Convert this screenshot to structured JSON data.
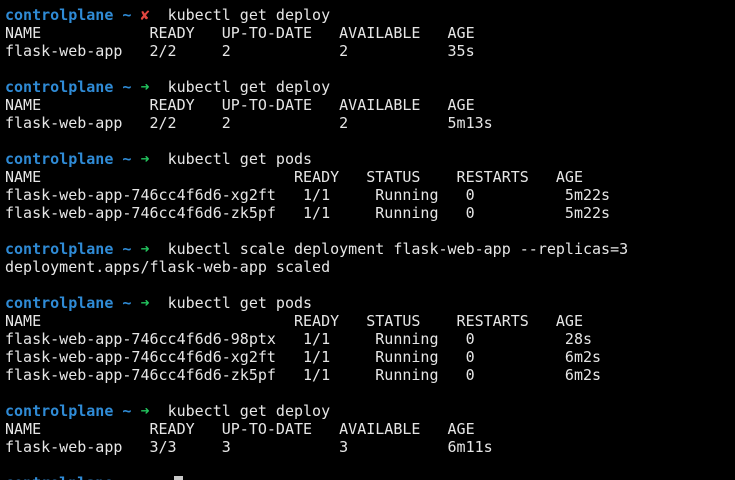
{
  "colors": {
    "background": "#000000",
    "prompt_host": "#2f8bd6",
    "status_fail": "#e0463f",
    "status_ok": "#22c55e",
    "text": "#e6e6e6"
  },
  "terminal": {
    "lines": [
      {
        "type": "prompt",
        "host": "controlplane",
        "tilde": "~",
        "status": "fail",
        "status_glyph": "✘",
        "command": "kubectl get deploy"
      },
      {
        "type": "output",
        "text": "NAME            READY   UP-TO-DATE   AVAILABLE   AGE"
      },
      {
        "type": "output",
        "text": "flask-web-app   2/2     2            2           35s"
      },
      {
        "type": "blank",
        "text": ""
      },
      {
        "type": "prompt",
        "host": "controlplane",
        "tilde": "~",
        "status": "ok",
        "status_glyph": "➜",
        "command": "kubectl get deploy"
      },
      {
        "type": "output",
        "text": "NAME            READY   UP-TO-DATE   AVAILABLE   AGE"
      },
      {
        "type": "output",
        "text": "flask-web-app   2/2     2            2           5m13s"
      },
      {
        "type": "blank",
        "text": ""
      },
      {
        "type": "prompt",
        "host": "controlplane",
        "tilde": "~",
        "status": "ok",
        "status_glyph": "➜",
        "command": "kubectl get pods"
      },
      {
        "type": "output",
        "text": "NAME                            READY   STATUS    RESTARTS   AGE"
      },
      {
        "type": "output",
        "text": "flask-web-app-746cc4f6d6-xg2ft   1/1     Running   0          5m22s"
      },
      {
        "type": "output",
        "text": "flask-web-app-746cc4f6d6-zk5pf   1/1     Running   0          5m22s"
      },
      {
        "type": "blank",
        "text": ""
      },
      {
        "type": "prompt",
        "host": "controlplane",
        "tilde": "~",
        "status": "ok",
        "status_glyph": "➜",
        "command": "kubectl scale deployment flask-web-app --replicas=3"
      },
      {
        "type": "output",
        "text": "deployment.apps/flask-web-app scaled"
      },
      {
        "type": "blank",
        "text": ""
      },
      {
        "type": "prompt",
        "host": "controlplane",
        "tilde": "~",
        "status": "ok",
        "status_glyph": "➜",
        "command": "kubectl get pods"
      },
      {
        "type": "output",
        "text": "NAME                            READY   STATUS    RESTARTS   AGE"
      },
      {
        "type": "output",
        "text": "flask-web-app-746cc4f6d6-98ptx   1/1     Running   0          28s"
      },
      {
        "type": "output",
        "text": "flask-web-app-746cc4f6d6-xg2ft   1/1     Running   0          6m2s"
      },
      {
        "type": "output",
        "text": "flask-web-app-746cc4f6d6-zk5pf   1/1     Running   0          6m2s"
      },
      {
        "type": "blank",
        "text": ""
      },
      {
        "type": "prompt",
        "host": "controlplane",
        "tilde": "~",
        "status": "ok",
        "status_glyph": "➜",
        "command": "kubectl get deploy"
      },
      {
        "type": "output",
        "text": "NAME            READY   UP-TO-DATE   AVAILABLE   AGE"
      },
      {
        "type": "output",
        "text": "flask-web-app   3/3     3            3           6m11s"
      },
      {
        "type": "blank",
        "text": ""
      },
      {
        "type": "prompt",
        "host": "controlplane",
        "tilde": "~",
        "status": "ok",
        "status_glyph": "➜",
        "command": "",
        "cursor": true
      }
    ]
  }
}
